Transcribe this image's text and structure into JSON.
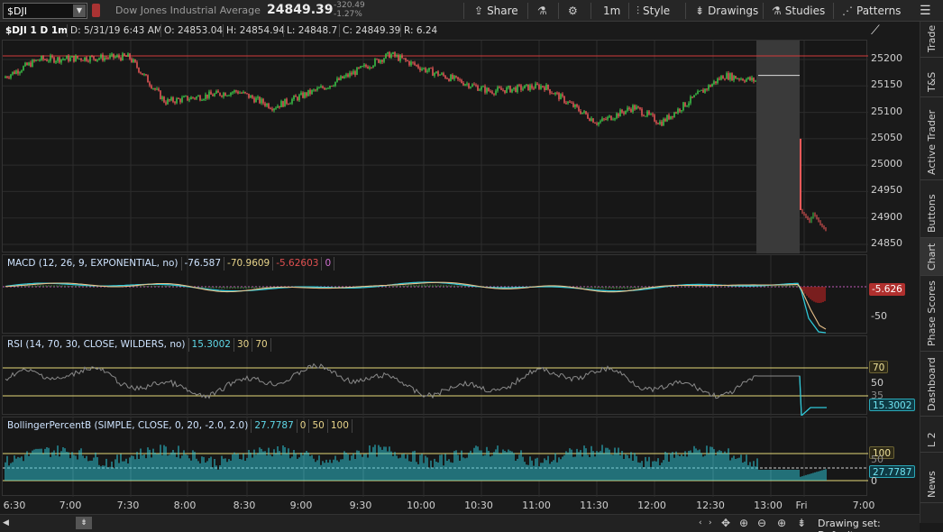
{
  "toolbar": {
    "symbol": "$DJI",
    "description": "Dow Jones Industrial Average",
    "last": "24849.39",
    "change": "-320.49",
    "change_pct": "-1.27%",
    "share": "Share",
    "timeframe": "1m",
    "style": "Style",
    "drawings": "Drawings",
    "studies": "Studies",
    "patterns": "Patterns"
  },
  "header": {
    "symbol_label": "$DJI 1 D 1m",
    "date": "D: 5/31/19 6:43 AM",
    "open": "O: 24853.04",
    "high": "H: 24854.94",
    "low": "L: 24848.7",
    "close": "C: 24849.39",
    "range": "R: 6.24"
  },
  "price_scale": [
    "25200",
    "25150",
    "25100",
    "25050",
    "25000",
    "24950",
    "24900",
    "24850"
  ],
  "macd": {
    "title": "MACD (12, 26, 9, EXPONENTIAL, no)",
    "value": "-76.587",
    "avg": "-70.9609",
    "diff": "-5.62603",
    "zero": "0",
    "tag": "-5.626",
    "scale_label": "-50"
  },
  "rsi": {
    "title": "RSI (14, 70, 30, CLOSE, WILDERS, no)",
    "value": "15.3002",
    "lower": "30",
    "upper": "70",
    "tag_70": "70",
    "scale_50": "50",
    "scale_35": "35",
    "tag_value": "15.3002"
  },
  "bpb": {
    "title": "BollingerPercentB (SIMPLE, CLOSE, 0, 20, -2.0, 2.0)",
    "value": "27.7787",
    "zero": "0",
    "fifty": "50",
    "hundred": "100",
    "tag_100": "100",
    "tag_value": "27.7787",
    "scale_50": "50",
    "scale_0": "0"
  },
  "time_axis": [
    "6:30",
    "7:00",
    "7:30",
    "8:00",
    "8:30",
    "9:00",
    "9:30",
    "10:00",
    "10:30",
    "11:00",
    "11:30",
    "12:00",
    "12:30",
    "13:00",
    "Fri",
    "7:00"
  ],
  "sidebar_tabs": [
    "Trade",
    "T&S",
    "Active Trader",
    "Buttons",
    "Chart",
    "Phase Scores",
    "Dashboard",
    "L 2",
    "News"
  ],
  "bottom": {
    "drawing_set": "Drawing set: Default"
  },
  "colors": {
    "up": "#3dcc4a",
    "down": "#f05a5a",
    "cyan": "#2ec8d8",
    "gray_line": "#8a8a8a",
    "yellow": "#e6d97a",
    "red_tag": "#b0302e"
  }
}
